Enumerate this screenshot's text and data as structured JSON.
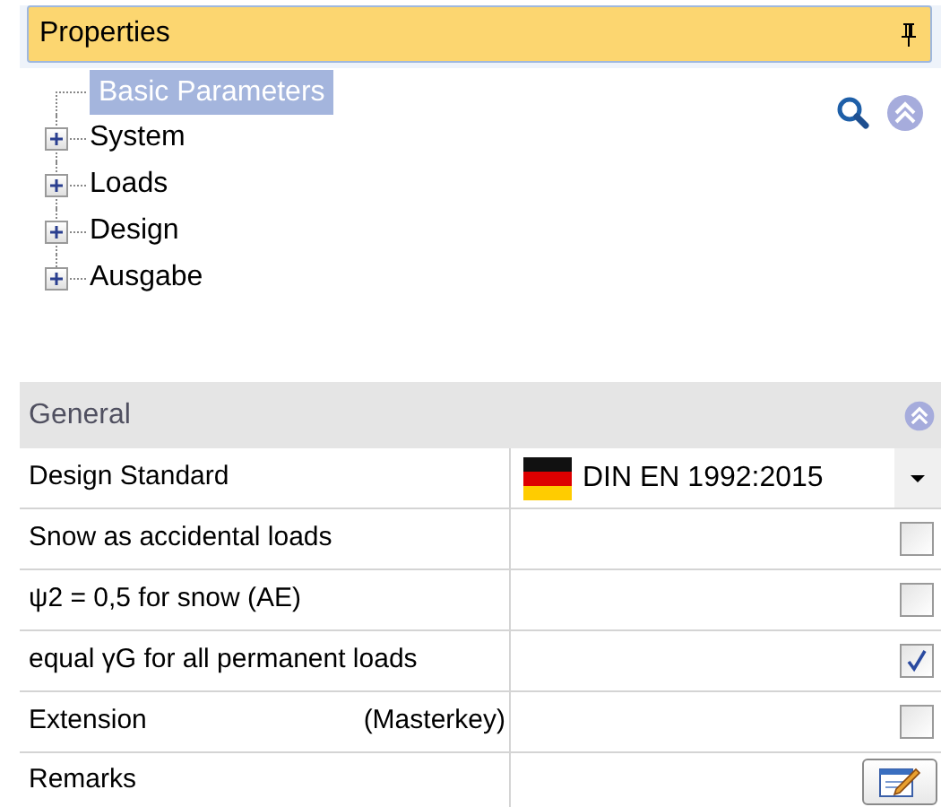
{
  "panel": {
    "title": "Properties"
  },
  "tree": [
    {
      "label": "Basic Parameters",
      "selected": true,
      "expandable": false
    },
    {
      "label": "System",
      "selected": false,
      "expandable": true
    },
    {
      "label": "Loads",
      "selected": false,
      "expandable": true
    },
    {
      "label": "Design",
      "selected": false,
      "expandable": true
    },
    {
      "label": "Ausgabe",
      "selected": false,
      "expandable": true
    }
  ],
  "section": {
    "title": "General"
  },
  "rows": [
    {
      "kind": "dropdown",
      "label": "Design Standard",
      "value": "DIN EN 1992:2015"
    },
    {
      "kind": "checkbox",
      "label": "Snow as accidental loads",
      "checked": false
    },
    {
      "kind": "checkbox",
      "label": "ψ2 = 0,5 for snow (AE)",
      "checked": false
    },
    {
      "kind": "checkbox",
      "label": "equal γG for all permanent loads",
      "checked": true
    },
    {
      "kind": "checkbox",
      "label": "Extension",
      "note": "(Masterkey)",
      "checked": false
    },
    {
      "kind": "edit",
      "label": "Remarks"
    }
  ]
}
